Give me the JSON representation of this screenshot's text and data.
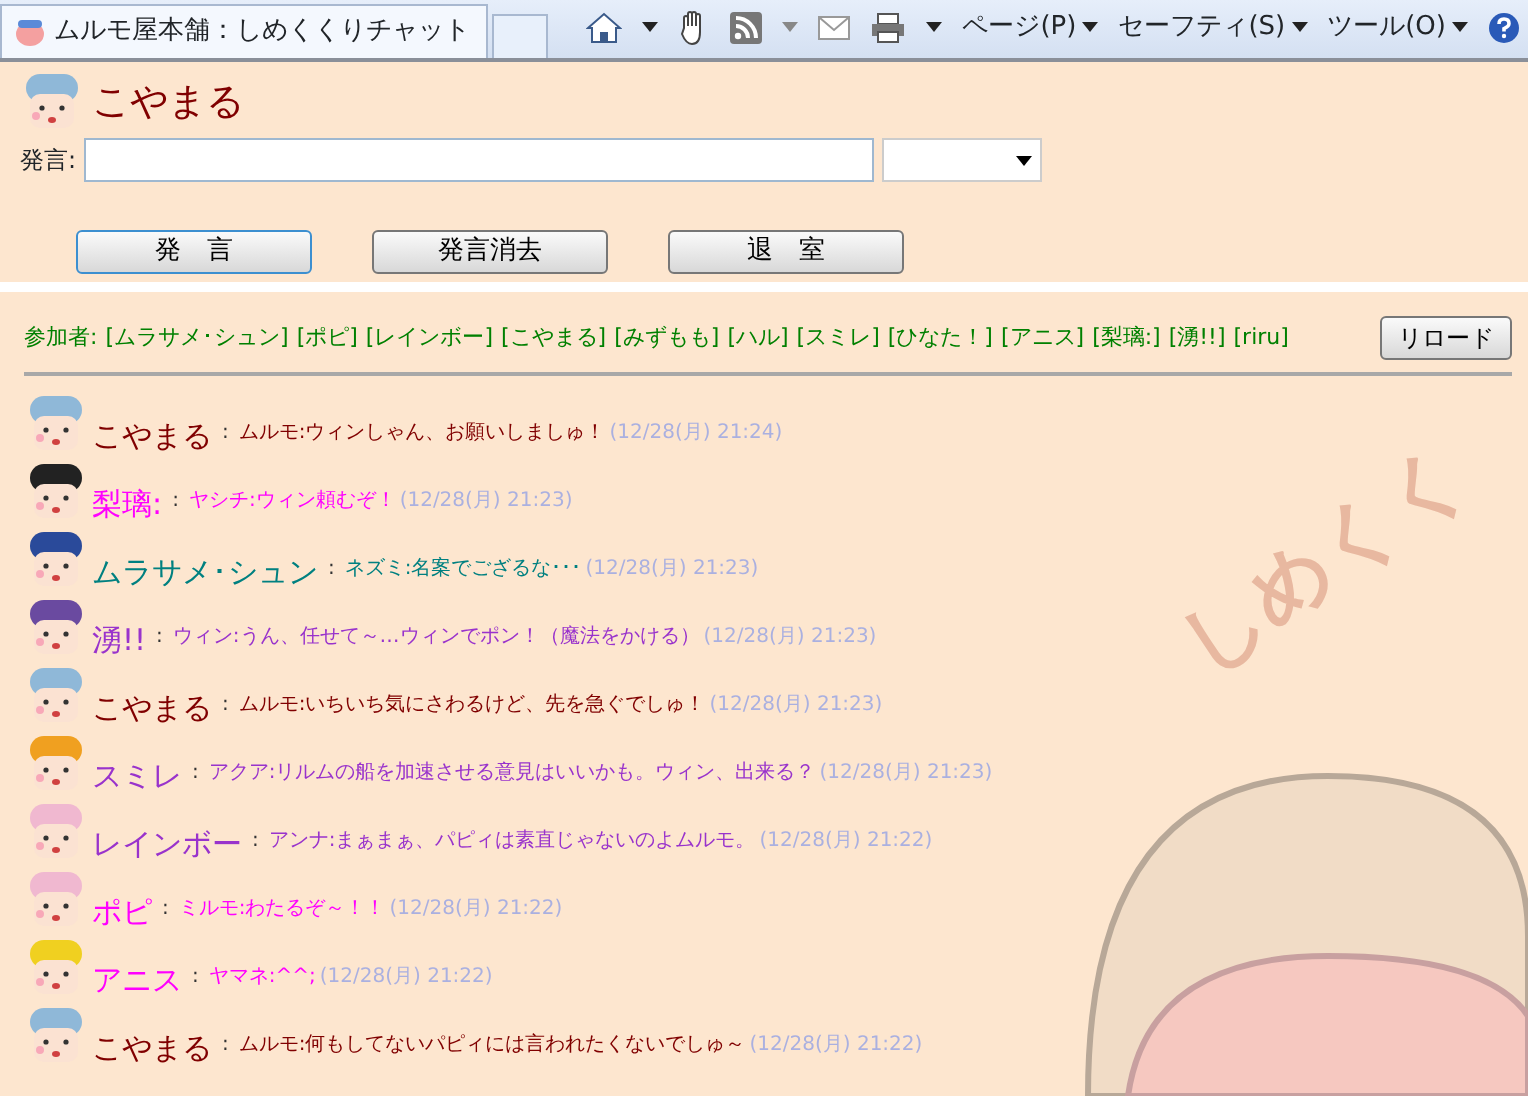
{
  "browser": {
    "tab_title": "ムルモ屋本舗：しめくくりチャット",
    "menus": [
      "ページ(P)",
      "セーフティ(S)",
      "ツール(O)"
    ]
  },
  "user": {
    "name": "こやまる",
    "avatar": {
      "color": "#8fb8d8"
    }
  },
  "form": {
    "label": "発言:",
    "buttons": [
      "発　言",
      "発言消去",
      "退　室"
    ]
  },
  "participants": {
    "label": "参加者:",
    "names": [
      "[ムラサメ･シュン]",
      "[ポピ]",
      "[レインボー]",
      "[こやまる]",
      "[みずもも]",
      "[ハル]",
      "[スミレ]",
      "[ひなた！]",
      "[アニス]",
      "[梨璃:]",
      "[湧!!]",
      "[riru]"
    ],
    "reload": "リロード"
  },
  "background_logo": "しめくく",
  "separator": ":",
  "messages": [
    {
      "name": "こやまる",
      "text": "ムルモ:ウィンしゃん、お願いしましゅ！",
      "time": "(12/28(月) 21:24)",
      "color": "#800000",
      "avatar": {
        "color": "#8fb8d8"
      }
    },
    {
      "name": "梨璃:",
      "text": "ヤシチ:ウィン頼むぞ！",
      "time": "(12/28(月) 21:23)",
      "color": "#ff00ff",
      "avatar": {
        "color": "#222222"
      }
    },
    {
      "name": "ムラサメ･シュン",
      "text": "ネズミ:名案でござるな･･･",
      "time": "(12/28(月) 21:23)",
      "color": "#008080",
      "avatar": {
        "color": "#2a4a9a"
      }
    },
    {
      "name": "湧!!",
      "text": "ウィン:うん、任せて～…ウィンでポン！（魔法をかける）",
      "time": "(12/28(月) 21:23)",
      "color": "#9933cc",
      "avatar": {
        "color": "#6a4aa0"
      }
    },
    {
      "name": "こやまる",
      "text": "ムルモ:いちいち気にさわるけど、先を急ぐでしゅ！",
      "time": "(12/28(月) 21:23)",
      "color": "#800000",
      "avatar": {
        "color": "#8fb8d8"
      }
    },
    {
      "name": "スミレ",
      "text": "アクア:リルムの船を加速させる意見はいいかも。ウィン、出来る？",
      "time": "(12/28(月) 21:23)",
      "color": "#9933cc",
      "avatar": {
        "color": "#f0a020"
      }
    },
    {
      "name": "レインボー",
      "text": "アンナ:まぁまぁ、パピィは素直じゃないのよムルモ。",
      "time": "(12/28(月) 21:22)",
      "color": "#9933cc",
      "avatar": {
        "color": "#f0b8d0"
      }
    },
    {
      "name": "ポピ",
      "text": "ミルモ:わたるぞ～！！",
      "time": "(12/28(月) 21:22)",
      "color": "#ff00ff",
      "avatar": {
        "color": "#f0b8d0"
      }
    },
    {
      "name": "アニス",
      "text": "ヤマネ:^^;",
      "time": "(12/28(月) 21:22)",
      "color": "#ff00ff",
      "avatar": {
        "color": "#f0d020"
      }
    },
    {
      "name": "こやまる",
      "text": "ムルモ:何もしてないパピィには言われたくないでしゅ～",
      "time": "(12/28(月) 21:22)",
      "color": "#800000",
      "avatar": {
        "color": "#8fb8d8"
      }
    }
  ]
}
